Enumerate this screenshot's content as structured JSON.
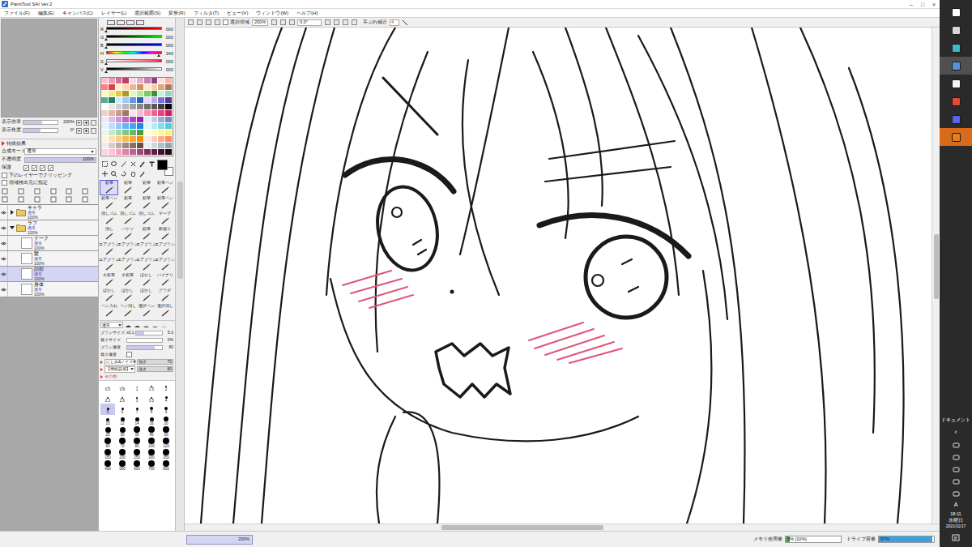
{
  "window": {
    "title": "PaintTool SAI Ver.2",
    "controls": [
      "–",
      "□",
      "×"
    ]
  },
  "menu": [
    "ファイル(F)",
    "編集(E)",
    "キャンバス(C)",
    "レイヤー(L)",
    "選択範囲(S)",
    "変形(R)",
    "フィルタ(T)",
    "ビュー(V)",
    "ウィンドウ(W)",
    "ヘルプ(H)"
  ],
  "navigator": {
    "zoom_label": "表示倍率",
    "zoom": "200%",
    "zoom_level": 0.55,
    "angle_label": "表示角度",
    "angle": "0°",
    "angle_level": 0.5
  },
  "layer_panel": {
    "effects": "特殊効果",
    "blend_label": "合成モード",
    "blend": "通常",
    "opacity_label": "不透明度",
    "opacity": "100%",
    "opacity_level": 1,
    "protect_label": "保護",
    "options": [
      {
        "label": "下のレイヤーでクリッピング",
        "checked": false
      },
      {
        "label": "領域検出元に指定",
        "checked": false
      }
    ]
  },
  "layers": [
    {
      "name": "キャラ",
      "mode": "通常",
      "opacity": "100%",
      "kind": "folder",
      "expanded": false,
      "nested": false,
      "visible": true,
      "selected": false
    },
    {
      "name": "ラフ",
      "mode": "通常",
      "opacity": "100%",
      "kind": "folder",
      "expanded": true,
      "nested": false,
      "visible": true,
      "selected": false
    },
    {
      "name": "テーク",
      "mode": "通常",
      "opacity": "100%",
      "kind": "layer",
      "expanded": false,
      "nested": true,
      "visible": true,
      "selected": false
    },
    {
      "name": "髪",
      "mode": "通常",
      "opacity": "100%",
      "kind": "layer",
      "expanded": false,
      "nested": true,
      "visible": true,
      "selected": false
    },
    {
      "name": "顔部",
      "mode": "通常",
      "opacity": "100%",
      "kind": "layer",
      "expanded": false,
      "nested": true,
      "visible": true,
      "selected": true
    },
    {
      "name": "身体",
      "mode": "通常",
      "opacity": "100%",
      "kind": "layer",
      "expanded": false,
      "nested": true,
      "visible": true,
      "selected": false
    }
  ],
  "color": {
    "sliders": [
      {
        "label": "R",
        "value": "000",
        "level": 0
      },
      {
        "label": "G",
        "value": "000",
        "level": 0
      },
      {
        "label": "B",
        "value": "000",
        "level": 0
      },
      {
        "label": "H",
        "value": "340",
        "level": 0.944
      },
      {
        "label": "S",
        "value": "000",
        "level": 0
      },
      {
        "label": "V",
        "value": "000",
        "level": 0
      }
    ],
    "current": "#000000",
    "background": "#ffffff"
  },
  "palette": [
    "#f4c2d0",
    "#e8a0b8",
    "#d8708f",
    "#c04060",
    "#f8d8e8",
    "#e0b0d0",
    "#c080b0",
    "#904080",
    "#ffe0e0",
    "#ffb0b0",
    "#ff8080",
    "#e04040",
    "#fff0d8",
    "#ffd8b0",
    "#f0b888",
    "#d09060",
    "#ffe8c8",
    "#f8d0a0",
    "#e0a878",
    "#b07850",
    "#fff8c0",
    "#f8e880",
    "#e0c840",
    "#b09820",
    "#e0f8c0",
    "#b8e890",
    "#80c860",
    "#409030",
    "#c8f0e0",
    "#90d8c0",
    "#50b090",
    "#208060",
    "#d0e8ff",
    "#a0c8f8",
    "#6098e0",
    "#3060b0",
    "#e0d8ff",
    "#b8a8f0",
    "#8070d0",
    "#504090",
    "#ffffff",
    "#e8e8e8",
    "#d0d0d0",
    "#b8b8b8",
    "#a0a0a0",
    "#888888",
    "#707070",
    "#585858",
    "#404040",
    "#000000",
    "#f0d0c0",
    "#e0b8a8",
    "#c89888",
    "#a07868",
    "#fce4ec",
    "#f8bbd0",
    "#f48fb1",
    "#f06292",
    "#ec407a",
    "#d81b60",
    "#f3e5f5",
    "#e1bee7",
    "#ce93d8",
    "#ba68c8",
    "#ab47bc",
    "#8e24aa",
    "#e8eaf6",
    "#c5cae9",
    "#9fa8da",
    "#7986cb",
    "#e3f2fd",
    "#bbdefb",
    "#90caf9",
    "#64b5f6",
    "#42a5f5",
    "#1e88e5",
    "#e0f7fa",
    "#b2ebf2",
    "#80deea",
    "#4dd0e1",
    "#e8f5e9",
    "#c8e6c9",
    "#a5d6a7",
    "#81c784",
    "#66bb6a",
    "#43a047",
    "#fffde7",
    "#fff9c4",
    "#fff59d",
    "#fff176",
    "#fff3e0",
    "#ffe0b2",
    "#ffcc80",
    "#ffb74d",
    "#ffa726",
    "#fb8c00",
    "#fbe9e7",
    "#ffccbc",
    "#ffab91",
    "#ff8a65",
    "#efebe9",
    "#d7ccc8",
    "#bcaaa4",
    "#a1887f",
    "#8d6e63",
    "#6d4c41",
    "#eceff1",
    "#cfd8dc",
    "#b0bec5",
    "#90a4ae",
    "#ffd0e0",
    "#ffc0d8",
    "#f8a0c0",
    "#e080a8",
    "#c06090",
    "#a04878",
    "#803060",
    "#602048",
    "#401030",
    "#200818"
  ],
  "brushes": [
    {
      "label": "鉛筆",
      "selected": true
    },
    {
      "label": "鉛筆",
      "selected": false
    },
    {
      "label": "鉛筆",
      "selected": false
    },
    {
      "label": "鉛筆ペン",
      "selected": false
    },
    {
      "label": "鉛筆ペン",
      "selected": false
    },
    {
      "label": "鉛筆",
      "selected": false
    },
    {
      "label": "鉛筆",
      "selected": false
    },
    {
      "label": "鉛筆ペン",
      "selected": false
    },
    {
      "label": "消しゴム",
      "selected": false
    },
    {
      "label": "消しゴム",
      "selected": false
    },
    {
      "label": "消しゴム",
      "selected": false
    },
    {
      "label": "テープ",
      "selected": false
    },
    {
      "label": "消し",
      "selected": false
    },
    {
      "label": "バケツ",
      "selected": false
    },
    {
      "label": "鉛筆",
      "selected": false
    },
    {
      "label": "影描り",
      "selected": false
    },
    {
      "label": "エアブラシ",
      "selected": false
    },
    {
      "label": "エアブラシ",
      "selected": false
    },
    {
      "label": "エアブラシ",
      "selected": false
    },
    {
      "label": "エアブラシ",
      "selected": false
    },
    {
      "label": "エアブラシ",
      "selected": false
    },
    {
      "label": "エアブラシ",
      "selected": false
    },
    {
      "label": "エアブラシ",
      "selected": false
    },
    {
      "label": "エアブラシ",
      "selected": false
    },
    {
      "label": "水彩筆",
      "selected": false
    },
    {
      "label": "水彩筆",
      "selected": false
    },
    {
      "label": "ぼかし",
      "selected": false
    },
    {
      "label": "バイナリ",
      "selected": false
    },
    {
      "label": "ぼかし",
      "selected": false
    },
    {
      "label": "ぼかし",
      "selected": false
    },
    {
      "label": "ぼかし",
      "selected": false
    },
    {
      "label": "グラデ",
      "selected": false
    },
    {
      "label": "ペン入れ",
      "selected": false
    },
    {
      "label": "ペン消し",
      "selected": false
    },
    {
      "label": "選択ペン",
      "selected": false
    },
    {
      "label": "選択消し",
      "selected": false
    }
  ],
  "brush_settings": {
    "shape": "通常",
    "size_label": "ブラシサイズ",
    "size_scale": "x0.1",
    "size": "5.0",
    "size_level": 0.3,
    "min_size_label": "最小サイズ",
    "min_size": "0%",
    "min_size_level": 0,
    "density_label": "ブラシ濃度",
    "density": "80",
    "density_level": 0.8,
    "min_density_label": "最小濃度",
    "min_density_checked": false,
    "blend_label": "にじみ&ノイズ",
    "blend_strength_label": "強さ",
    "blend_strength": "70",
    "texture_label": "【用紙質感】",
    "texture_strength_label": "強さ",
    "texture_strength": "80",
    "more": "その他"
  },
  "sizes": [
    {
      "value": "0.5",
      "selected": false
    },
    {
      "value": "0.8",
      "selected": false
    },
    {
      "value": "1",
      "selected": false
    },
    {
      "value": "1.5",
      "selected": false
    },
    {
      "value": "2",
      "selected": false
    },
    {
      "value": "2.3",
      "selected": false
    },
    {
      "value": "2.6",
      "selected": false
    },
    {
      "value": "3",
      "selected": false
    },
    {
      "value": "3.5",
      "selected": false
    },
    {
      "value": "4",
      "selected": false
    },
    {
      "value": "5",
      "selected": true
    },
    {
      "value": "6",
      "selected": false
    },
    {
      "value": "7",
      "selected": false
    },
    {
      "value": "8",
      "selected": false
    },
    {
      "value": "9",
      "selected": false
    },
    {
      "value": "10",
      "selected": false
    },
    {
      "value": "12",
      "selected": false
    },
    {
      "value": "14",
      "selected": false
    },
    {
      "value": "16",
      "selected": false
    },
    {
      "value": "20",
      "selected": false
    },
    {
      "value": "25",
      "selected": false
    },
    {
      "value": "30",
      "selected": false
    },
    {
      "value": "35",
      "selected": false
    },
    {
      "value": "40",
      "selected": false
    },
    {
      "value": "50",
      "selected": false
    },
    {
      "value": "60",
      "selected": false
    },
    {
      "value": "70",
      "selected": false
    },
    {
      "value": "80",
      "selected": false
    },
    {
      "value": "100",
      "selected": false
    },
    {
      "value": "120",
      "selected": false
    },
    {
      "value": "160",
      "selected": false
    },
    {
      "value": "200",
      "selected": false
    },
    {
      "value": "250",
      "selected": false
    },
    {
      "value": "300",
      "selected": false
    },
    {
      "value": "350",
      "selected": false
    },
    {
      "value": "400",
      "selected": false
    },
    {
      "value": "500",
      "selected": false
    },
    {
      "value": "600",
      "selected": false
    },
    {
      "value": "700",
      "selected": false
    },
    {
      "value": "800",
      "selected": false
    }
  ],
  "canvas_toolbar": {
    "selection_label": "選択領域",
    "zoom": "200%",
    "angle": "0.0°",
    "stabilizer_label": "手ぶれ補正",
    "stabilizer": "4"
  },
  "canvas_tabs": [
    {
      "label": "200%",
      "selected": true
    }
  ],
  "status": {
    "memory_label": "メモリ使用量",
    "memory": "8% (10%)",
    "memory_level": 0.08,
    "drive_label": "ドライブ容量",
    "drive": "97%",
    "drive_level": 0.97
  },
  "taskbar": {
    "apps": [
      {
        "color": "#ffffff",
        "selected": false
      },
      {
        "color": "#d8d8d8",
        "selected": false
      },
      {
        "color": "#3fb8c8",
        "selected": false
      },
      {
        "color": "#5a8fd8",
        "selected": true
      },
      {
        "color": "#f4f4f4",
        "selected": false
      },
      {
        "color": "#e04a3a",
        "selected": false
      },
      {
        "color": "#5865f2",
        "selected": false
      },
      {
        "color": "#e67e22",
        "selected": true
      }
    ],
    "documents": "ドキュメント",
    "chevron": "‹",
    "ime": "A",
    "time": "18:11",
    "day": "水曜日",
    "date": "2021/11/17"
  }
}
